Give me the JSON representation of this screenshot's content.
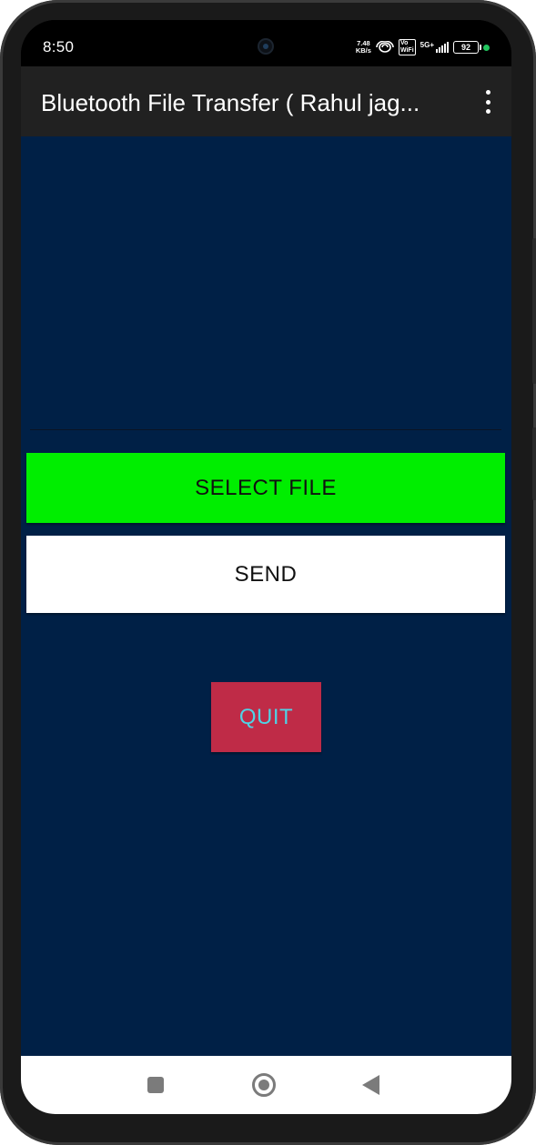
{
  "status_bar": {
    "time": "8:50",
    "net_speed_value": "7.48",
    "net_speed_unit": "KB/s",
    "hd_label": "Vo\nWiFi",
    "network_type": "5G+",
    "battery_level": "92",
    "signal_strength": 4,
    "icons": [
      "hotspot-icon",
      "volte-icon",
      "signal-icon",
      "battery-icon",
      "privacy-dot-icon"
    ]
  },
  "app_bar": {
    "title": "Bluetooth File Transfer ( Rahul jag...",
    "menu_icon": "overflow-menu-icon"
  },
  "main": {
    "background_color": "#002046",
    "select_file_label": "SELECT FILE",
    "select_file_color": "#00ee00",
    "send_label": "SEND",
    "send_color": "#ffffff",
    "quit_label": "QUIT",
    "quit_color": "#bf2b47",
    "quit_text_color": "#4fd3e6"
  },
  "nav_bar": {
    "icons": [
      "recents-icon",
      "home-icon",
      "back-icon"
    ]
  }
}
